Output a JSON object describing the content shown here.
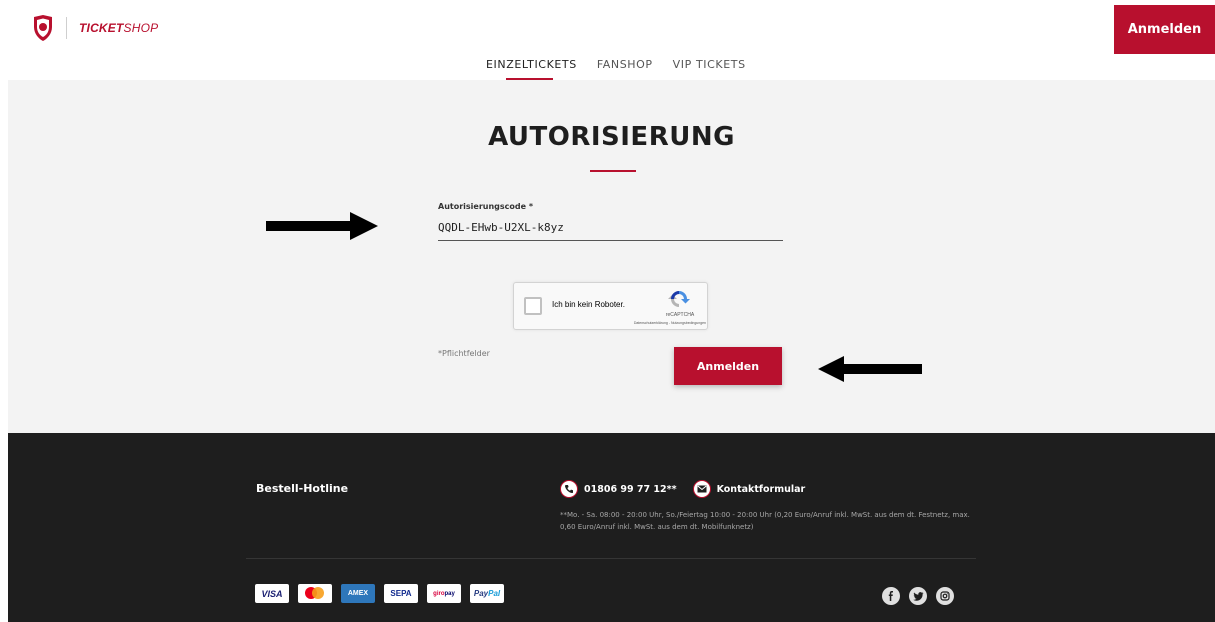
{
  "header": {
    "logo_text_bold": "TICKET",
    "logo_text_light": "SHOP",
    "login_button": "Anmelden",
    "nav": [
      {
        "label": "EINZELTICKETS",
        "active": true
      },
      {
        "label": "FANSHOP",
        "active": false
      },
      {
        "label": "VIP TICKETS",
        "active": false
      }
    ]
  },
  "main": {
    "title": "AUTORISIERUNG",
    "auth_field": {
      "label": "Autorisierungscode *",
      "value": "QQDL-EHwb-U2XL-k8yz"
    },
    "captcha": {
      "label": "Ich bin kein Roboter.",
      "brand": "reCAPTCHA",
      "links": "Datenschutzerklärung - Nutzungsbedingungen"
    },
    "required_note": "*Pflichtfelder",
    "submit_label": "Anmelden"
  },
  "footer": {
    "hotline_title": "Bestell-Hotline",
    "phone": "01806 99 77 12**",
    "contact_label": "Kontaktformular",
    "hours_note": "**Mo. - Sa. 08:00 - 20:00 Uhr, So./Feiertag 10:00 - 20:00 Uhr (0,20 Euro/Anruf inkl. MwSt. aus dem dt. Festnetz, max. 0,60 Euro/Anruf inkl. MwSt. aus dem dt. Mobilfunknetz)",
    "payments": {
      "visa": "VISA",
      "amex": "AMEX",
      "sepa": "SEPA",
      "giro_a": "giro",
      "giro_b": "pay",
      "paypal_a": "Pay",
      "paypal_b": "Pal"
    },
    "social_icons": [
      "facebook-icon",
      "twitter-icon",
      "instagram-icon"
    ]
  },
  "colors": {
    "accent": "#b8102e",
    "footer_bg": "#1e1e1e",
    "main_bg": "#f3f3f3"
  }
}
